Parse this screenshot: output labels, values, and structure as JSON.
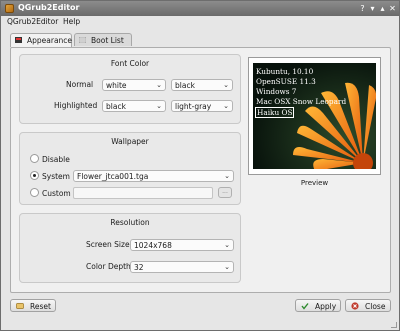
{
  "window": {
    "title": "QGrub2Editor"
  },
  "menubar": {
    "items": [
      "QGrub2Editor",
      "Help"
    ]
  },
  "tabs": [
    {
      "label": "Appearance",
      "active": true
    },
    {
      "label": "Boot List",
      "active": false
    }
  ],
  "font_color": {
    "title": "Font Color",
    "normal": {
      "label": "Normal",
      "fg": "white",
      "bg": "black"
    },
    "highlighted": {
      "label": "Highlighted",
      "fg": "black",
      "bg": "light-gray"
    }
  },
  "wallpaper": {
    "title": "Wallpaper",
    "options": [
      {
        "label": "Disable",
        "selected": false
      },
      {
        "label": "System",
        "selected": true
      },
      {
        "label": "Custom",
        "selected": false
      }
    ],
    "system_value": "Flower_jtca001.tga",
    "custom_value": "",
    "browse_label": "..."
  },
  "resolution": {
    "title": "Resolution",
    "screen_size": {
      "label": "Screen Size",
      "value": "1024x768"
    },
    "color_depth": {
      "label": "Color Depth",
      "value": "32"
    }
  },
  "preview": {
    "caption": "Preview",
    "entries": [
      "Kubuntu, 10.10",
      "OpenSUSE 11.3",
      "Windows 7",
      "Mac OSX Snow Leopard",
      "Haiku OS"
    ],
    "selected_index": 4
  },
  "buttons": {
    "reset": "Reset",
    "apply": "Apply",
    "close": "Close"
  },
  "colors": {
    "titlebar": "#7a7a7a",
    "accent_apply": "#2e8b2e",
    "accent_close": "#c0392b",
    "flower": "#f08a1c"
  }
}
